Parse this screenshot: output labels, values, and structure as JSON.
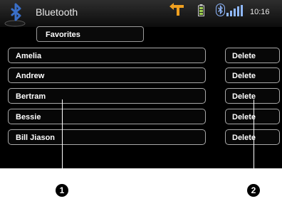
{
  "app": {
    "title": "Bluetooth",
    "clock": "10:16"
  },
  "favorites": {
    "label": "Favorites"
  },
  "contacts": [
    {
      "name": "Amelia",
      "delete_label": "Delete"
    },
    {
      "name": "Andrew",
      "delete_label": "Delete"
    },
    {
      "name": "Bertram",
      "delete_label": "Delete"
    },
    {
      "name": "Bessie",
      "delete_label": "Delete"
    },
    {
      "name": "Bill Jiason",
      "delete_label": "Delete"
    }
  ],
  "callouts": [
    {
      "number": "1"
    },
    {
      "number": "2"
    }
  ],
  "icons": {
    "app_logo": "bluetooth-logo-icon",
    "navigation": "navigation-arrow-icon",
    "battery": "battery-icon",
    "bluetooth_status": "bluetooth-status-icon",
    "signal": "signal-strength-icon"
  },
  "colors": {
    "screen_bg": "#000000",
    "text": "#ffffff",
    "border": "#a8a8a8",
    "nav_arrow": "#f0a020",
    "battery": "#9ccc50",
    "bluetooth_logo": "#3a6fc8"
  }
}
